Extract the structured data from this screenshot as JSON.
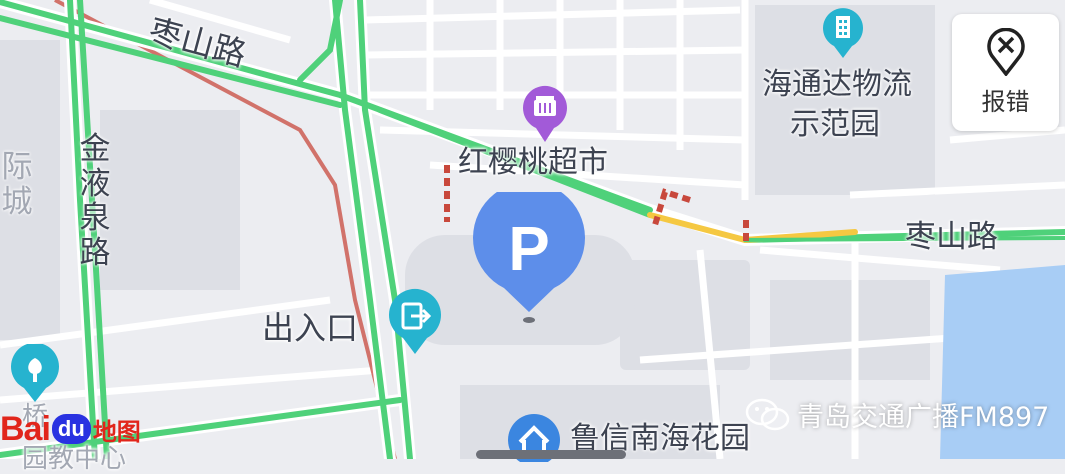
{
  "colors": {
    "road_smooth": "#4fd17a",
    "road_slow": "#f5c842",
    "road_congested": "#c8483c",
    "water": "#a8cdf5",
    "parking_pin": "#5d8eea",
    "poi_teal": "#26b3cf",
    "poi_purple": "#a25ad8",
    "baidu_red": "#e1251b",
    "baidu_blue": "#2932e1"
  },
  "roads": {
    "zaoshan_road_left": "枣山路",
    "zaoshan_road_right": "枣山路",
    "jinyequan_road": "金液泉路"
  },
  "pois": {
    "supermarket": {
      "name": "红樱桃超市",
      "icon": "shopping-basket-icon"
    },
    "logistics": {
      "name_line1": "海通达物流",
      "name_line2": "示范园",
      "icon": "office-building-icon"
    },
    "entrance": {
      "name": "出入口",
      "icon": "entrance-icon"
    },
    "residential": {
      "name": "鲁信南海花园",
      "icon": "house-icon"
    },
    "park": {
      "icon": "tree-icon"
    },
    "parking": {
      "label": "P",
      "icon": "parking-icon"
    }
  },
  "faint_labels": {
    "district_partial": "际城",
    "bridge_partial": "桥",
    "bottom_partial": "园教中心"
  },
  "report_button": {
    "label": "报错",
    "icon": "report-error-icon"
  },
  "logo": {
    "bai": "Bai",
    "du": "du",
    "ditu": "地图"
  },
  "watermark": {
    "text": "青岛交通广播FM897",
    "icon": "wechat-icon"
  }
}
